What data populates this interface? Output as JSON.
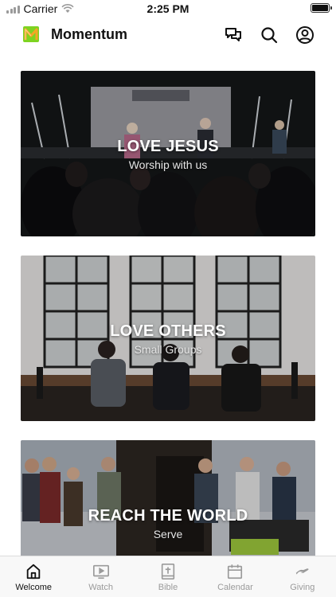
{
  "status_bar": {
    "carrier": "Carrier",
    "time": "2:25 PM"
  },
  "header": {
    "title": "Momentum",
    "icons": [
      "chat-icon",
      "search-icon",
      "profile-icon"
    ]
  },
  "cards": [
    {
      "title": "LOVE JESUS",
      "subtitle": "Worship with us"
    },
    {
      "title": "LOVE OTHERS",
      "subtitle": "Small Groups"
    },
    {
      "title": "REACH THE WORLD",
      "subtitle": "Serve"
    }
  ],
  "tabs": [
    {
      "label": "Welcome",
      "icon": "home-icon",
      "active": true
    },
    {
      "label": "Watch",
      "icon": "video-icon",
      "active": false
    },
    {
      "label": "Bible",
      "icon": "bible-icon",
      "active": false
    },
    {
      "label": "Calendar",
      "icon": "calendar-icon",
      "active": false
    },
    {
      "label": "Giving",
      "icon": "giving-icon",
      "active": false
    }
  ],
  "colors": {
    "active_tab": "#111111",
    "inactive_tab": "#9a9a9a",
    "logo_green": "#7ed321",
    "logo_orange": "#f5a623"
  }
}
